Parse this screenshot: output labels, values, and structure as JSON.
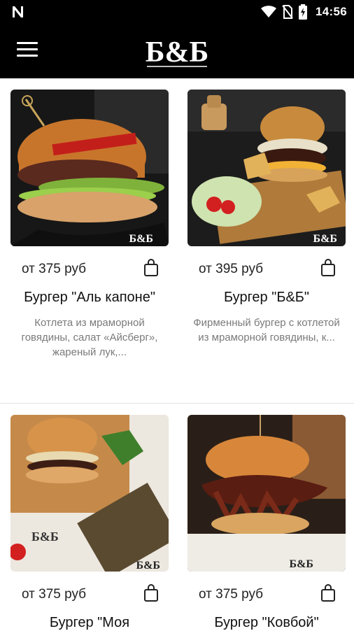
{
  "status_bar": {
    "time": "14:56",
    "left_icon": "n-logo-icon",
    "icons": [
      "wifi-icon",
      "no-sim-icon",
      "battery-charging-icon"
    ]
  },
  "app_bar": {
    "logo_text": "Б&Б",
    "menu_icon": "hamburger-menu-icon"
  },
  "colors": {
    "bar_background": "#000000",
    "page_background": "#ffffff",
    "text_primary": "#111111",
    "text_secondary": "#7a7a7a"
  },
  "products": [
    {
      "price": "от 375 руб",
      "title": "Бургер \"Аль капоне\"",
      "description": "Котлета из мраморной говядины, салат «Айсберг», жареный лук,...",
      "image_label": "Б&Б",
      "icon": "shopping-bag-icon"
    },
    {
      "price": "от 395 руб",
      "title": "Бургер \"Б&Б\"",
      "description": "Фирменный бургер с котлетой из мраморной говядины, к...",
      "image_label": "Б&Б",
      "icon": "shopping-bag-icon"
    },
    {
      "price": "от 375 руб",
      "title": "Бургер \"Моя",
      "description": "",
      "image_label": "Б&Б",
      "icon": "shopping-bag-icon"
    },
    {
      "price": "от 375 руб",
      "title": "Бургер \"Ковбой\"",
      "description": "",
      "image_label": "Б&Б",
      "icon": "shopping-bag-icon"
    }
  ]
}
